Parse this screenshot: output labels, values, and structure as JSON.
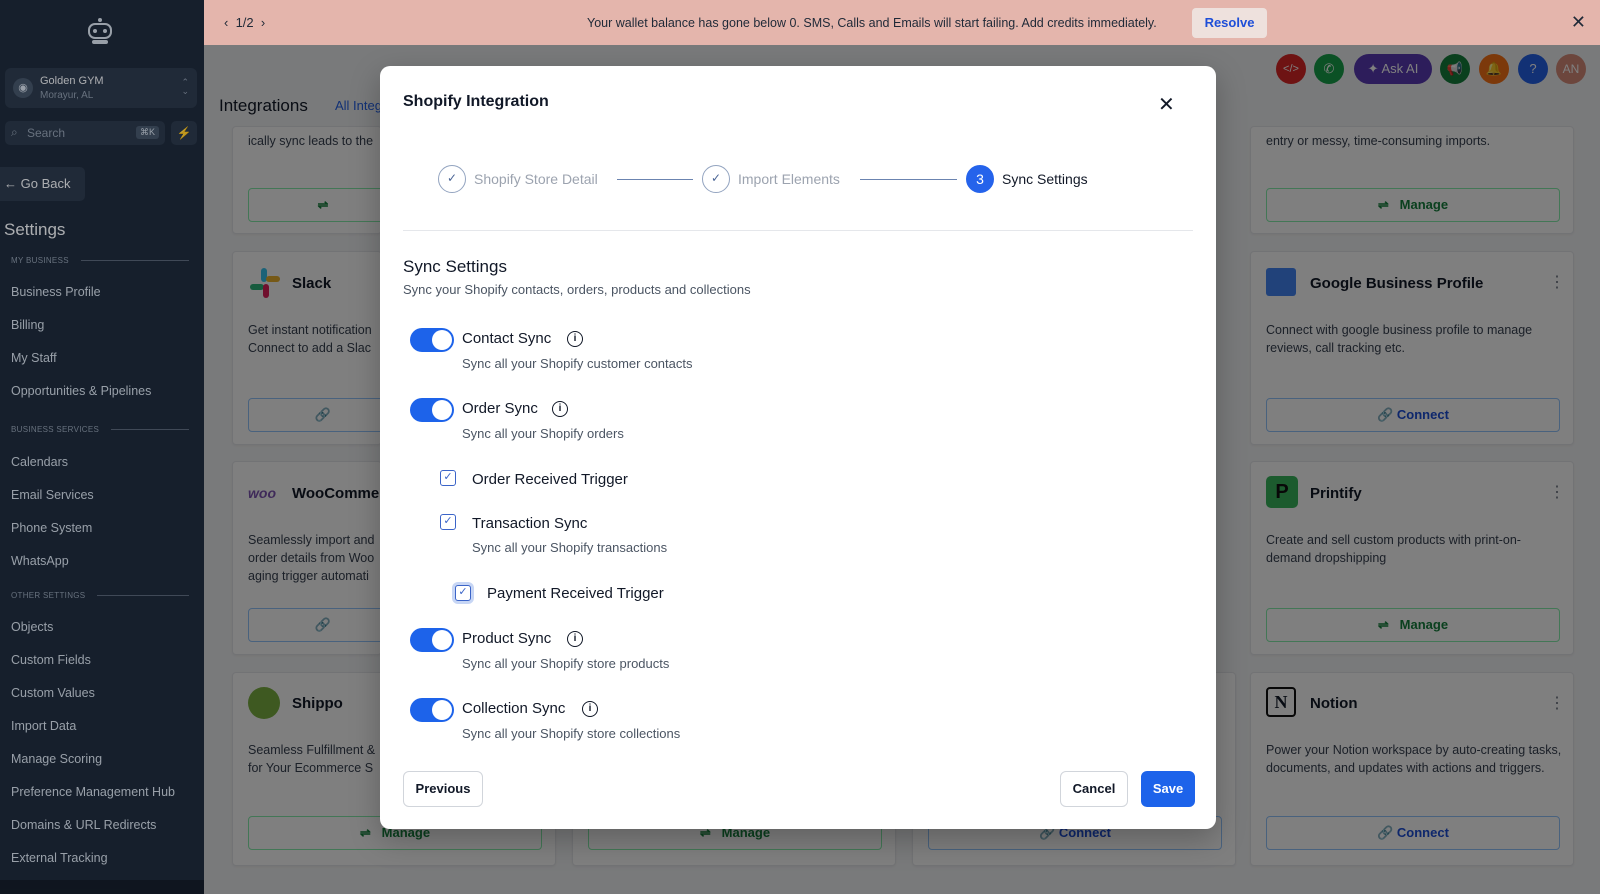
{
  "sidebar": {
    "account_name": "Golden GYM",
    "account_location": "Morayur, AL",
    "search_placeholder": "Search",
    "search_shortcut": "⌘K",
    "go_back": "Go Back",
    "title": "Settings",
    "sections": [
      "MY BUSINESS",
      "BUSINESS SERVICES",
      "OTHER SETTINGS"
    ],
    "items": [
      "Business Profile",
      "Billing",
      "My Staff",
      "Opportunities & Pipelines",
      "Calendars",
      "Email Services",
      "Phone System",
      "WhatsApp",
      "Objects",
      "Custom Fields",
      "Custom Values",
      "Import Data",
      "Manage Scoring",
      "Preference Management Hub",
      "Domains & URL Redirects",
      "External Tracking"
    ]
  },
  "banner": {
    "pager": "1/2",
    "message": "Your wallet balance has gone below 0. SMS, Calls and Emails will start failing. Add credits immediately.",
    "resolve": "Resolve"
  },
  "topbar": {
    "ask_ai": "Ask AI",
    "help": "?",
    "avatar": "AN"
  },
  "page": {
    "title": "Integrations",
    "tab_all": "All Integ",
    "cards": {
      "leads_desc": "ically sync leads to the",
      "right_top_desc": "entry or messy, time-consuming imports.",
      "manage": "Manage",
      "connect": "Connect",
      "slack_name": "Slack",
      "slack_desc": "Get instant notification\nConnect to add a Slac",
      "gbp_name": "Google Business Profile",
      "gbp_desc": "Connect with google business profile to manage reviews, call tracking etc.",
      "woo_name": "WooCommer",
      "woo_desc": "Seamlessly import and\norder details from Woo\naging trigger automati",
      "printify_name": "Printify",
      "printify_desc": "Create and sell custom products with print-on-demand dropshipping",
      "shippo_name": "Shippo",
      "shippo_desc": "Seamless Fulfillment &\nfor Your Ecommerce S",
      "notion_name": "Notion",
      "notion_desc": "Power your Notion workspace by auto-creating tasks, documents, and updates with actions and triggers."
    }
  },
  "modal": {
    "title": "Shopify Integration",
    "steps": [
      {
        "label": "Shopify Store Detail",
        "mark": "✓"
      },
      {
        "label": "Import Elements",
        "mark": "✓"
      },
      {
        "label": "Sync Settings",
        "mark": "3"
      }
    ],
    "section_title": "Sync Settings",
    "section_subtitle": "Sync your Shopify contacts, orders, products and collections",
    "contact_sync": {
      "label": "Contact Sync",
      "desc": "Sync all your Shopify customer contacts",
      "enabled": true
    },
    "order_sync": {
      "label": "Order Sync",
      "desc": "Sync all your Shopify orders",
      "enabled": true
    },
    "order_received_trigger": {
      "label": "Order Received Trigger",
      "checked": true
    },
    "transaction_sync": {
      "label": "Transaction Sync",
      "desc": "Sync all your Shopify transactions",
      "checked": true
    },
    "payment_received_trigger": {
      "label": "Payment Received Trigger",
      "checked": true
    },
    "product_sync": {
      "label": "Product Sync",
      "desc": "Sync all your Shopify store products",
      "enabled": true
    },
    "collection_sync": {
      "label": "Collection Sync",
      "desc": "Sync all your Shopify store collections",
      "enabled": true
    },
    "buttons": {
      "previous": "Previous",
      "cancel": "Cancel",
      "save": "Save"
    }
  },
  "colors": {
    "primary": "#1d63ea",
    "sidebar": "#1e2a3b",
    "banner": "#e4b5ac"
  }
}
